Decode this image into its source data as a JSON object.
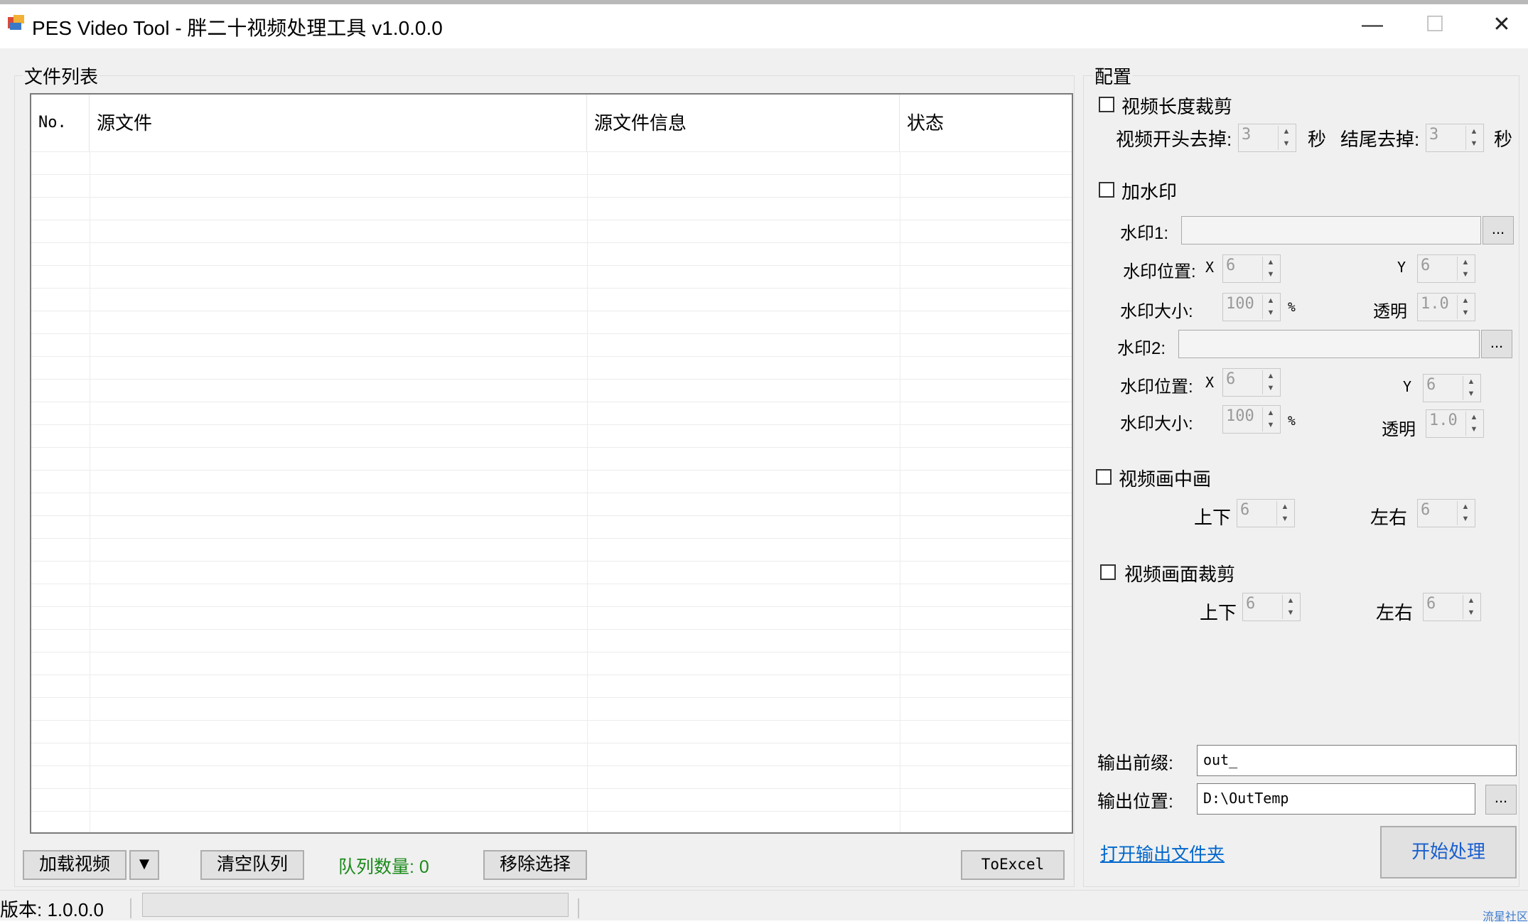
{
  "window": {
    "title": "PES Video Tool - 胖二十视频处理工具 v1.0.0.0",
    "minimize": "—",
    "maximize": "☐",
    "close": "✕"
  },
  "file_list": {
    "group_label": "文件列表",
    "columns": [
      "No.",
      "源文件",
      "源文件信息",
      "状态"
    ],
    "rows": []
  },
  "bottom_bar": {
    "load_video": "加载视频",
    "dropdown_arrow": "▼",
    "clear_queue": "清空队列",
    "queue_count_label": "队列数量: 0",
    "remove_selected": "移除选择",
    "to_excel": "ToExcel"
  },
  "config": {
    "group_label": "配置",
    "trim": {
      "label": "视频长度裁剪",
      "checked": false,
      "start_label": "视频开头去掉:",
      "start_value": "3",
      "sec1": "秒",
      "end_label": "结尾去掉:",
      "end_value": "3",
      "sec2": "秒"
    },
    "watermark": {
      "label": "加水印",
      "checked": false,
      "wm1_label": "水印1:",
      "wm1_value": "",
      "wm1_browse": "...",
      "pos1_label": "水印位置:",
      "x_label": "X",
      "x1_value": "6",
      "y_label": "Y",
      "y1_value": "6",
      "size1_label": "水印大小:",
      "size1_value": "100",
      "percent": "%",
      "alpha1_label": "透明",
      "alpha1_value": "1.0",
      "wm2_label": "水印2:",
      "wm2_value": "",
      "wm2_browse": "...",
      "pos2_label": "水印位置:",
      "x2_value": "6",
      "y2_value": "6",
      "size2_label": "水印大小:",
      "size2_value": "100",
      "alpha2_label": "透明",
      "alpha2_value": "1.0"
    },
    "pip": {
      "label": "视频画中画",
      "checked": false,
      "ud_label": "上下",
      "ud_value": "6",
      "lr_label": "左右",
      "lr_value": "6"
    },
    "crop": {
      "label": "视频画面裁剪",
      "checked": false,
      "ud_label": "上下",
      "ud_value": "6",
      "lr_label": "左右",
      "lr_value": "6"
    },
    "output": {
      "prefix_label": "输出前缀:",
      "prefix_value": "out_",
      "location_label": "输出位置:",
      "location_value": "D:\\OutTemp",
      "browse": "...",
      "open_folder_link": "打开输出文件夹",
      "start_button": "开始处理"
    }
  },
  "status_bar": {
    "version": "版本: 1.0.0.0",
    "progress": 0,
    "corner_text": "流星社区"
  },
  "colors": {
    "queue_count": "#1a8a1a",
    "link": "#0066cc",
    "start_text": "#1a5fd0",
    "form_bg": "#f0f0f0"
  }
}
